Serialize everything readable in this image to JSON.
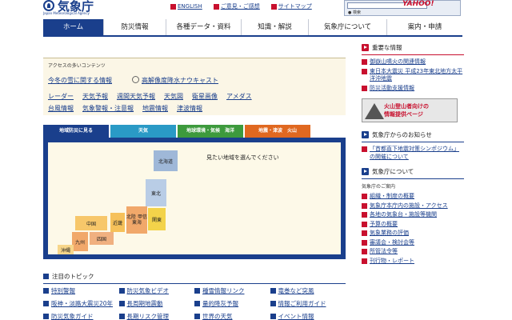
{
  "header": {
    "logo_text": "気象庁",
    "logo_sub": "Japan Meteorological Agency",
    "links": [
      "ENGLISH",
      "ご意見・ご感想",
      "サイトマップ"
    ],
    "search_brand": "YAHOO!",
    "search_option": "● 検索"
  },
  "gnav": [
    "ホーム",
    "防災情報",
    "各種データ・資料",
    "知識・解説",
    "気象庁について",
    "案内・申請"
  ],
  "quick": {
    "title": "アクセスの多いコンテンツ",
    "row1": [
      "今冬の雪に関する情報",
      "高解像度降水ナウキャスト"
    ],
    "row2": [
      "レーダー",
      "天気予報",
      "週間天気予報",
      "天気図",
      "衛星画像",
      "アメダス"
    ],
    "row3": [
      "台風情報",
      "気象警報・注意報",
      "地震情報",
      "津波情報"
    ]
  },
  "tabs": [
    {
      "label": "地域防災に見る",
      "color": "#1a3f8c"
    },
    {
      "label": "天気",
      "color": "#2a9ac6"
    },
    {
      "label": "地球環境・気候　海洋",
      "color": "#3d9a3d"
    },
    {
      "label": "地震・津波　火山",
      "color": "#e06820"
    }
  ],
  "map": {
    "prompt": "見たい地域を選んでください",
    "regions": [
      "北海道",
      "東北",
      "関東",
      "北陸 甲信 東海",
      "近畿",
      "中国",
      "四国",
      "九州",
      "沖縄"
    ]
  },
  "topics": {
    "title": "注目のトピック",
    "items": [
      "特別警報",
      "防災気象ビデオ",
      "種雪情報リンク",
      "竜巻など突風",
      "阪神・淡路大震災20年",
      "長周期地震動",
      "量的降灰予報",
      "情報ご利用ガイド",
      "防災気象ガイド",
      "長期リスク管理",
      "世界の天気",
      "イベント情報"
    ]
  },
  "right": {
    "important_title": "重要な情報",
    "important": [
      "御嶽山噴火の関連情報",
      "東日本大震災 平成23年東北地方太平洋沖地震",
      "防災活動支援情報"
    ],
    "banner": [
      "火山登山者向けの",
      "情報提供ページ"
    ],
    "notice_title": "気象庁からのお知らせ",
    "notices": [
      "「首都直下地震対策シンポジウム」の開催について"
    ],
    "about_title": "気象庁について",
    "about_sub": "気象庁のご案内",
    "about": [
      "組織・制度の概要",
      "気象庁本庁内の施設・アクセス",
      "各地の気象台・施設等機関",
      "予算の概要",
      "気象業務の評価",
      "審議会・検討会等",
      "所管法令等",
      "刊行物・レポート"
    ]
  }
}
